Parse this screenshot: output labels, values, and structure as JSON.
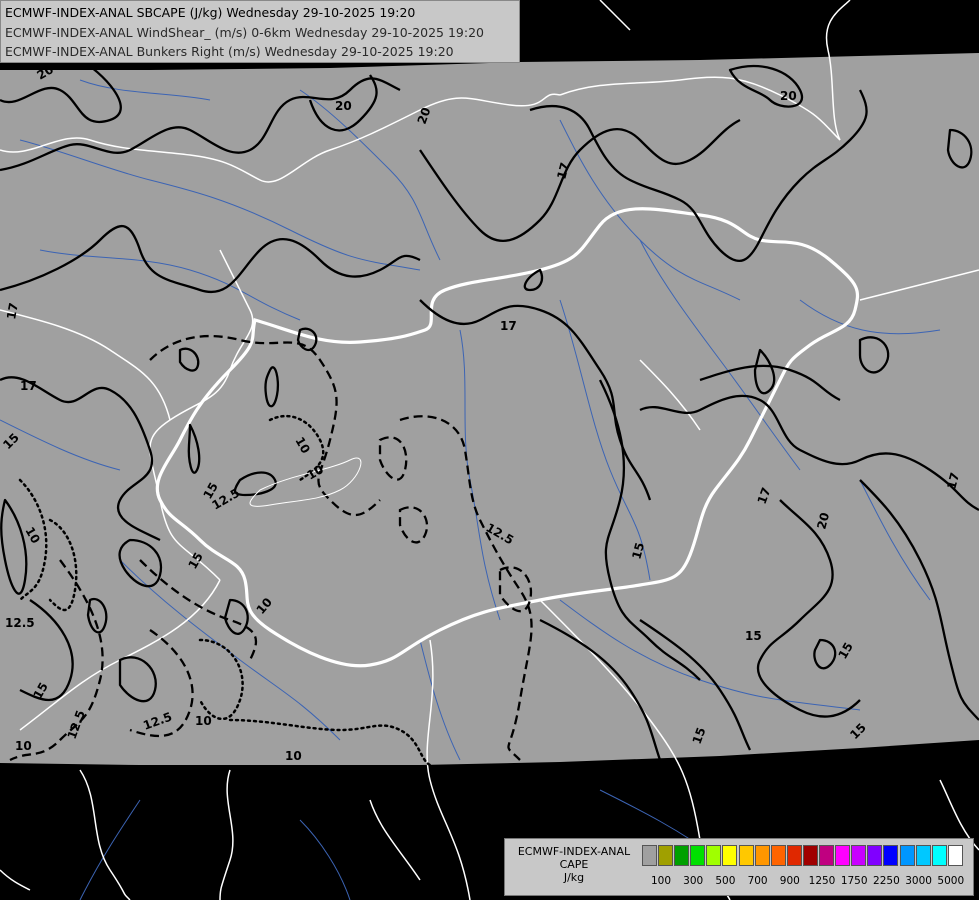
{
  "titles": [
    "ECMWF-INDEX-ANAL SBCAPE (J/kg) Wednesday 29-10-2025 19:20",
    "ECMWF-INDEX-ANAL WindShear_ (m/s) 0-6km Wednesday 29-10-2025 19:20",
    "ECMWF-INDEX-ANAL Bunkers Right (m/s) Wednesday 29-10-2025 19:20"
  ],
  "legend": {
    "title_lines": [
      "ECMWF-INDEX-ANAL",
      "CAPE",
      "J/kg"
    ],
    "colors": [
      "#a0a0a0",
      "#a0a000",
      "#00a000",
      "#00e000",
      "#a0ff00",
      "#ffff00",
      "#ffc800",
      "#ff9600",
      "#ff6400",
      "#e02800",
      "#a00000",
      "#c00080",
      "#ff00ff",
      "#c800ff",
      "#8000ff",
      "#0000ff",
      "#0096ff",
      "#00c8ff",
      "#00ffff",
      "#ffffff"
    ],
    "tick_labels": [
      "100",
      "300",
      "500",
      "700",
      "900",
      "1250",
      "1750",
      "2250",
      "3000",
      "5000"
    ]
  },
  "contour_labels": [
    {
      "text": "20"
    },
    {
      "text": "20"
    },
    {
      "text": "20"
    },
    {
      "text": "20"
    },
    {
      "text": "17"
    },
    {
      "text": "17"
    },
    {
      "text": "17"
    },
    {
      "text": "17"
    },
    {
      "text": "17"
    },
    {
      "text": "17"
    },
    {
      "text": "20"
    },
    {
      "text": "15"
    },
    {
      "text": "15"
    },
    {
      "text": "15"
    },
    {
      "text": "15"
    },
    {
      "text": "15"
    },
    {
      "text": "15"
    },
    {
      "text": "15"
    },
    {
      "text": "15"
    },
    {
      "text": "15"
    },
    {
      "text": "12.5"
    },
    {
      "text": "12.5"
    },
    {
      "text": "12.5"
    },
    {
      "text": "12.5"
    },
    {
      "text": "12.5"
    },
    {
      "text": "10"
    },
    {
      "text": "10"
    },
    {
      "text": "10"
    },
    {
      "text": "10"
    },
    {
      "text": "10"
    },
    {
      "text": "10"
    },
    {
      "text": "10"
    }
  ]
}
